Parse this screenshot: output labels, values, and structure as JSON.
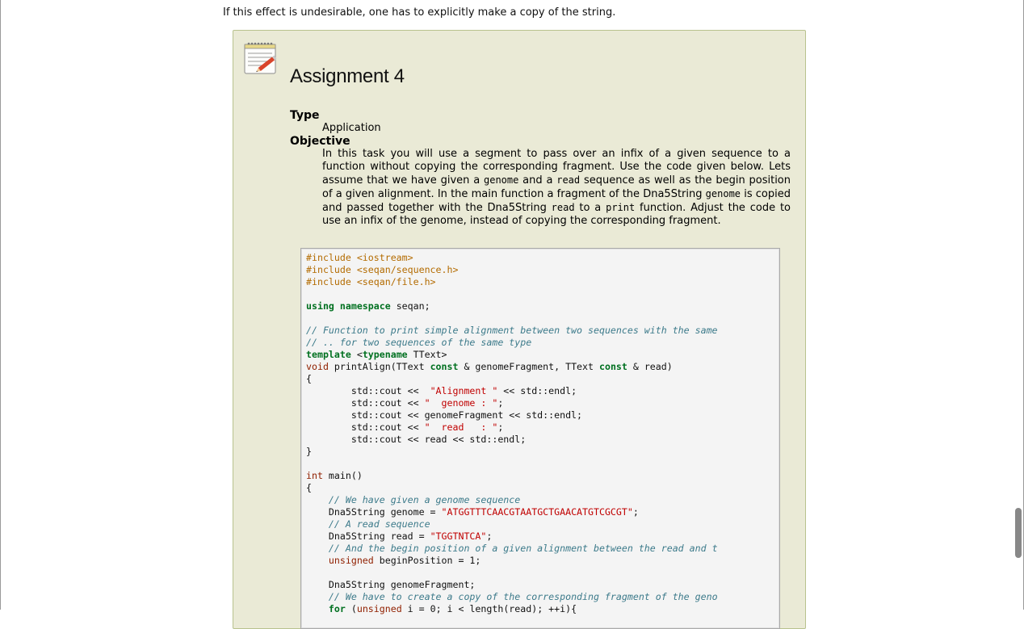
{
  "intro_text": "If this effect is undesirable, one has to explicitly make a copy of the string.",
  "assignment": {
    "title": "Assignment 4",
    "type_label": "Type",
    "type_value": "Application",
    "objective_label": "Objective",
    "objective_parts": {
      "p1": "In this task you will use a segment to pass over an infix of a given sequence to a function without copying the corresponding fragment. Use the code given below. Lets assume that we have given a ",
      "c1": "genome",
      "p2": " and a ",
      "c2": "read",
      "p3": " sequence as well as the begin position of a given alignment. In the main function a fragment of the Dna5String ",
      "c3": "genome",
      "p4": " is copied and passed together with the Dna5String ",
      "c4": "read",
      "p5": " to a ",
      "c5": "print",
      "p6": " function. Adjust the code to use an infix of the genome, instead of copying the corresponding fragment."
    }
  },
  "code_lines": [
    [
      [
        "pp",
        "#include <iostream>"
      ]
    ],
    [
      [
        "pp",
        "#include <seqan/sequence.h>"
      ]
    ],
    [
      [
        "pp",
        "#include <seqan/file.h>"
      ]
    ],
    [],
    [
      [
        "kw",
        "using"
      ],
      [
        "",
        " "
      ],
      [
        "kw",
        "namespace"
      ],
      [
        "",
        " seqan;"
      ]
    ],
    [],
    [
      [
        "cm",
        "// Function to print simple alignment between two sequences with the same"
      ]
    ],
    [
      [
        "cm",
        "// .. for two sequences of the same type"
      ]
    ],
    [
      [
        "kw",
        "template"
      ],
      [
        "",
        " <"
      ],
      [
        "kw",
        "typename"
      ],
      [
        "",
        " TText>"
      ]
    ],
    [
      [
        "ty",
        "void"
      ],
      [
        "",
        " printAlign(TText "
      ],
      [
        "kw",
        "const"
      ],
      [
        "",
        " & genomeFragment, TText "
      ],
      [
        "kw",
        "const"
      ],
      [
        "",
        " & read)"
      ]
    ],
    [
      [
        "",
        "{"
      ]
    ],
    [
      [
        "",
        "        std::cout <<  "
      ],
      [
        "st",
        "\"Alignment \""
      ],
      [
        "",
        " << std::endl;"
      ]
    ],
    [
      [
        "",
        "        std::cout << "
      ],
      [
        "st",
        "\"  genome : \""
      ],
      [
        "",
        ";"
      ]
    ],
    [
      [
        "",
        "        std::cout << genomeFragment << std::endl;"
      ]
    ],
    [
      [
        "",
        "        std::cout << "
      ],
      [
        "st",
        "\"  read   : \""
      ],
      [
        "",
        ";"
      ]
    ],
    [
      [
        "",
        "        std::cout << read << std::endl;"
      ]
    ],
    [
      [
        "",
        "}"
      ]
    ],
    [],
    [
      [
        "ty",
        "int"
      ],
      [
        "",
        " main()"
      ]
    ],
    [
      [
        "",
        "{"
      ]
    ],
    [
      [
        "",
        "    "
      ],
      [
        "cm",
        "// We have given a genome sequence"
      ]
    ],
    [
      [
        "",
        "    Dna5String genome = "
      ],
      [
        "st",
        "\"ATGGTTTCAACGTAATGCTGAACATGTCGCGT\""
      ],
      [
        "",
        ";"
      ]
    ],
    [
      [
        "",
        "    "
      ],
      [
        "cm",
        "// A read sequence"
      ]
    ],
    [
      [
        "",
        "    Dna5String read = "
      ],
      [
        "st",
        "\"TGGTNTCA\""
      ],
      [
        "",
        ";"
      ]
    ],
    [
      [
        "",
        "    "
      ],
      [
        "cm",
        "// And the begin position of a given alignment between the read and t"
      ]
    ],
    [
      [
        "",
        "    "
      ],
      [
        "ty",
        "unsigned"
      ],
      [
        "",
        " beginPosition = 1;"
      ]
    ],
    [],
    [
      [
        "",
        "    Dna5String genomeFragment;"
      ]
    ],
    [
      [
        "",
        "    "
      ],
      [
        "cm",
        "// We have to create a copy of the corresponding fragment of the geno"
      ]
    ],
    [
      [
        "",
        "    "
      ],
      [
        "kw",
        "for"
      ],
      [
        "",
        " ("
      ],
      [
        "ty",
        "unsigned"
      ],
      [
        "",
        " i = 0; i < length(read); ++i){"
      ]
    ]
  ],
  "icon_name": "notepad-pencil-icon"
}
